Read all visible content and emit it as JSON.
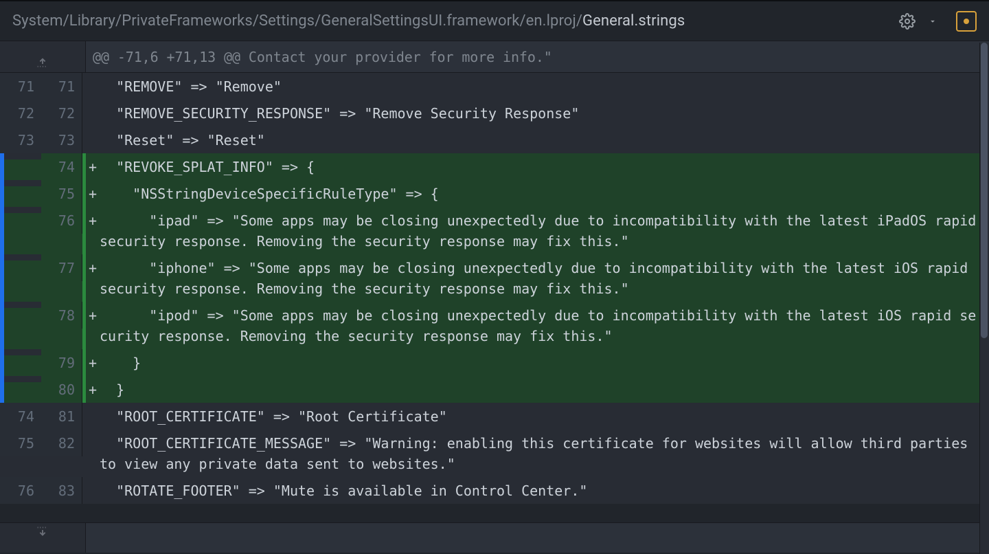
{
  "header": {
    "breadcrumb_path": "System/Library/PrivateFrameworks/Settings/GeneralSettingsUI.framework/en.lproj/",
    "breadcrumb_file": "General.strings"
  },
  "hunk": {
    "header": "@@ -71,6 +71,13 @@ Contact your provider for more info.\""
  },
  "rows": [
    {
      "old": "71",
      "new": "71",
      "type": "ctx",
      "text": "  \"REMOVE\" => \"Remove\""
    },
    {
      "old": "72",
      "new": "72",
      "type": "ctx",
      "text": "  \"REMOVE_SECURITY_RESPONSE\" => \"Remove Security Response\""
    },
    {
      "old": "73",
      "new": "73",
      "type": "ctx",
      "text": "  \"Reset\" => \"Reset\""
    },
    {
      "old": "",
      "new": "74",
      "type": "added",
      "text": "  \"REVOKE_SPLAT_INFO\" => {"
    },
    {
      "old": "",
      "new": "75",
      "type": "added",
      "text": "    \"NSStringDeviceSpecificRuleType\" => {"
    },
    {
      "old": "",
      "new": "76",
      "type": "added",
      "text": "      \"ipad\" => \"Some apps may be closing unexpectedly due to incompatibility with the latest iPadOS rapid security response. Removing the security response may fix this.\""
    },
    {
      "old": "",
      "new": "77",
      "type": "added",
      "text": "      \"iphone\" => \"Some apps may be closing unexpectedly due to incompatibility with the latest iOS rapid security response. Removing the security response may fix this.\""
    },
    {
      "old": "",
      "new": "78",
      "type": "added",
      "text": "      \"ipod\" => \"Some apps may be closing unexpectedly due to incompatibility with the latest iOS rapid security response. Removing the security response may fix this.\""
    },
    {
      "old": "",
      "new": "79",
      "type": "added",
      "text": "    }"
    },
    {
      "old": "",
      "new": "80",
      "type": "added",
      "text": "  }"
    },
    {
      "old": "74",
      "new": "81",
      "type": "ctx",
      "text": "  \"ROOT_CERTIFICATE\" => \"Root Certificate\""
    },
    {
      "old": "75",
      "new": "82",
      "type": "ctx",
      "text": "  \"ROOT_CERTIFICATE_MESSAGE\" => \"Warning: enabling this certificate for websites will allow third parties to view any private data sent to websites.\""
    },
    {
      "old": "76",
      "new": "83",
      "type": "ctx",
      "text": "  \"ROTATE_FOOTER\" => \"Mute is available in Control Center.\""
    }
  ]
}
